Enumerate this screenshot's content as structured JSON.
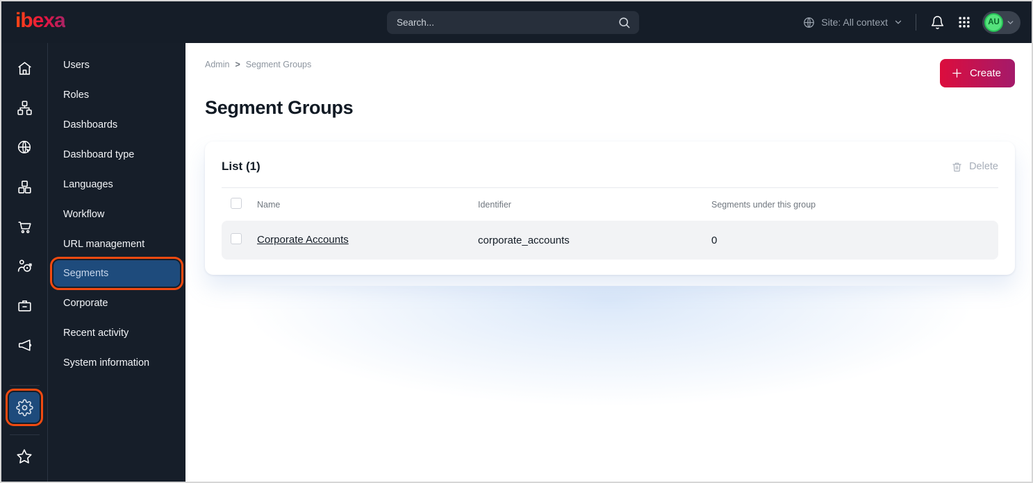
{
  "topbar": {
    "logo": "ibexa",
    "search": {
      "placeholder": "Search..."
    },
    "site_selector": {
      "label": "Site: All context"
    },
    "avatar": {
      "initials": "AU"
    }
  },
  "icon_rail": {
    "icons": [
      "home",
      "content-tree",
      "site",
      "product-catalog",
      "commerce",
      "personalization",
      "subscriptions",
      "marketing"
    ],
    "bottom_icons": [
      "settings",
      "bookmarks"
    ],
    "active": "settings"
  },
  "sidebar": {
    "items": [
      {
        "label": "Users"
      },
      {
        "label": "Roles"
      },
      {
        "label": "Dashboards"
      },
      {
        "label": "Dashboard type"
      },
      {
        "label": "Languages"
      },
      {
        "label": "Workflow"
      },
      {
        "label": "URL management"
      },
      {
        "label": "Segments",
        "active": true
      },
      {
        "label": "Corporate"
      },
      {
        "label": "Recent activity"
      },
      {
        "label": "System information"
      }
    ]
  },
  "breadcrumb": {
    "items": [
      "Admin",
      "Segment Groups"
    ],
    "separator": ">"
  },
  "page": {
    "title": "Segment Groups"
  },
  "actions": {
    "create_label": "Create"
  },
  "list_card": {
    "title": "List (1)",
    "delete_label": "Delete",
    "columns": [
      "Name",
      "Identifier",
      "Segments under this group"
    ],
    "rows": [
      {
        "name": "Corporate Accounts",
        "identifier": "corporate_accounts",
        "segments_under_group": "0"
      }
    ]
  },
  "colors": {
    "topbar_bg": "#151d28",
    "accent_orange": "#f24a10",
    "active_blue": "#1e4b7c",
    "primary_gradient_start": "#dc0d3d",
    "primary_gradient_end": "#a41a6a",
    "avatar_green": "#55e27c"
  }
}
